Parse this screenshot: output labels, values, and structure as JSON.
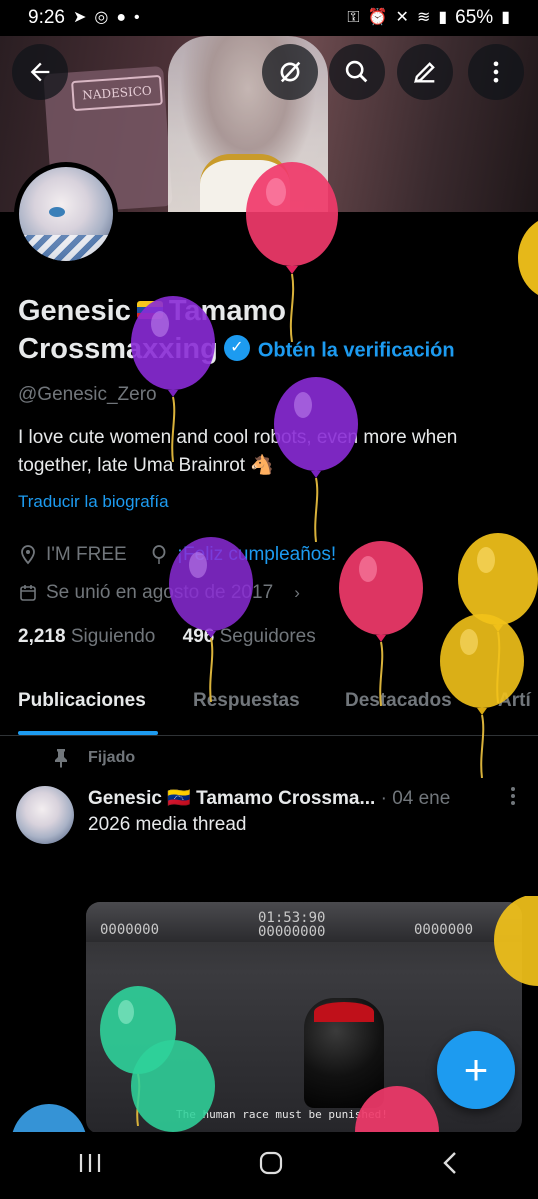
{
  "status_bar": {
    "time": "9:26",
    "battery": "65%"
  },
  "header": {
    "back_icon": "arrow-left-icon",
    "actions": [
      "grok-icon",
      "search-icon",
      "edit-icon",
      "more-vertical-icon"
    ]
  },
  "banner": {
    "sign_text": "NADESICO"
  },
  "profile": {
    "name_part1": "Genesic",
    "name_part2": "Tamamo",
    "name_line2": "Crossmaxxing",
    "verify_label": "Obtén la verificación",
    "handle": "@Genesic_Zero",
    "bio": "I love cute women and cool robots, even more when together, late Uma Brainrot 🐴",
    "translate_label": "Traducir la biografía",
    "location": "I'M FREE",
    "birthday": "¡Feliz cumpleaños!",
    "joined": "Se unió en agosto de 2017",
    "following_count": "2,218",
    "following_label": "Siguiendo",
    "followers_count": "496",
    "followers_label": "Seguidores"
  },
  "tabs": [
    "Publicaciones",
    "Respuestas",
    "Destacados",
    "Artí"
  ],
  "pinned_post": {
    "pinned_label": "Fijado",
    "author": "Genesic 🇻🇪 Tamamo Crossma...",
    "time": "· 04 ene",
    "text": "2026 media thread",
    "media": {
      "timer": "01:53:90",
      "score_left": "0000000",
      "score_mid": "00000000",
      "score_right": "0000000",
      "caption": "The human race must be punished!"
    }
  },
  "fab_label": "+",
  "colors": {
    "accent": "#1d9bf0",
    "background": "#000000",
    "muted": "#71767b"
  }
}
